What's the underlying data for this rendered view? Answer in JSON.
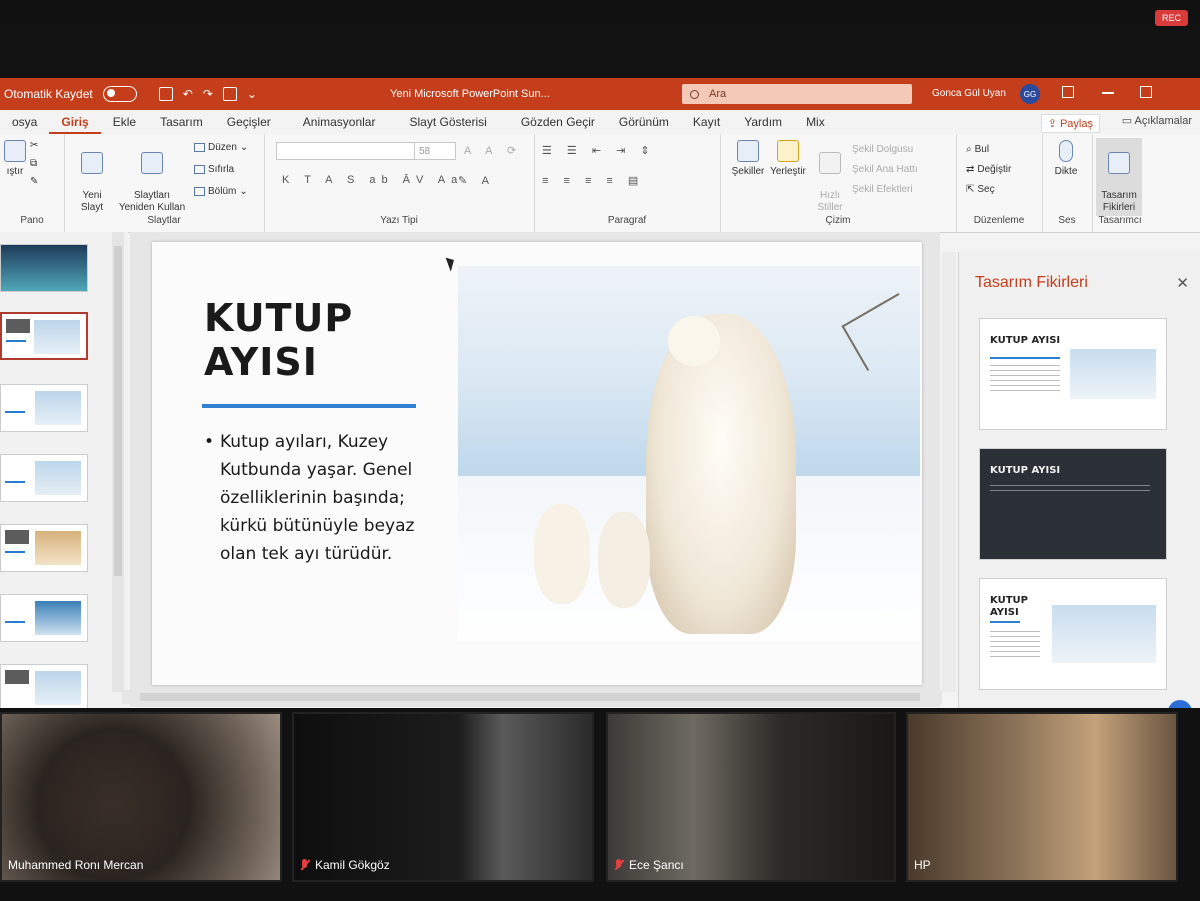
{
  "window": {
    "autosave_label": "Otomatik Kaydet",
    "doc_title": "Yeni Microsoft PowerPoint Sun...",
    "search_placeholder": "Ara",
    "user_name": "Gonca Gül Uyan",
    "user_initials": "GG"
  },
  "tabs": [
    "osya",
    "Giriş",
    "Ekle",
    "Tasarım",
    "Geçişler",
    "Animasyonlar",
    "Slayt Gösterisi",
    "Gözden Geçir",
    "Görünüm",
    "Kayıt",
    "Yardım",
    "Mix"
  ],
  "share_label": "Paylaş",
  "comments_label": "Açıklamalar",
  "ribbon": {
    "pano": {
      "yapistir": "ıştır",
      "label": "Pano"
    },
    "slaytlar": {
      "yeni": "Yeni\nSlayt",
      "yeniden": "Slaytları\nYeniden Kullan",
      "duzen": "Düzen",
      "sifirla": "Sıfırla",
      "bolum": "Bölüm",
      "label": "Slaytlar"
    },
    "yazi_tipi": {
      "size": "58",
      "label": "Yazı Tipi"
    },
    "paragraf": {
      "label": "Paragraf"
    },
    "cizim": {
      "sekiller": "Şekiller",
      "yerlestir": "Yerleştir",
      "hizli": "Hızlı\nStiller",
      "dolgu": "Şekil Dolgusu",
      "ana_hat": "Şekil Ana Hattı",
      "efekt": "Şekil Efektleri",
      "label": "Çizim"
    },
    "duzenleme": {
      "bul": "Bul",
      "degistir": "Değiştir",
      "sec": "Seç",
      "label": "Düzenleme"
    },
    "ses": {
      "dikte": "Dikte",
      "label": "Ses"
    },
    "tasarimci": {
      "fikirler": "Tasarım\nFikirleri",
      "label": "Tasarımcı"
    }
  },
  "slide": {
    "title": "KUTUP\nAYISI",
    "bullet": "Kutup ayıları, Kuzey Kutbunda yaşar. Genel özelliklerinin başında; kürkü bütünüyle beyaz olan tek ayı türüdür."
  },
  "design_panel": {
    "title": "Tasarım Fikirleri",
    "card_titles": [
      "KUTUP AYISI",
      "KUTUP AYISI",
      "KUTUP\nAYISI"
    ]
  },
  "participants": [
    {
      "name": "Muhammed Ronı Mercan",
      "muted": false
    },
    {
      "name": "Kamil Gökgöz",
      "muted": true
    },
    {
      "name": "Ece Şancı",
      "muted": true
    },
    {
      "name": "HP",
      "muted": false
    }
  ],
  "rec_label": "REC",
  "colors": {
    "accent": "#c43e1c",
    "slide_rule": "#2f7fd3"
  }
}
